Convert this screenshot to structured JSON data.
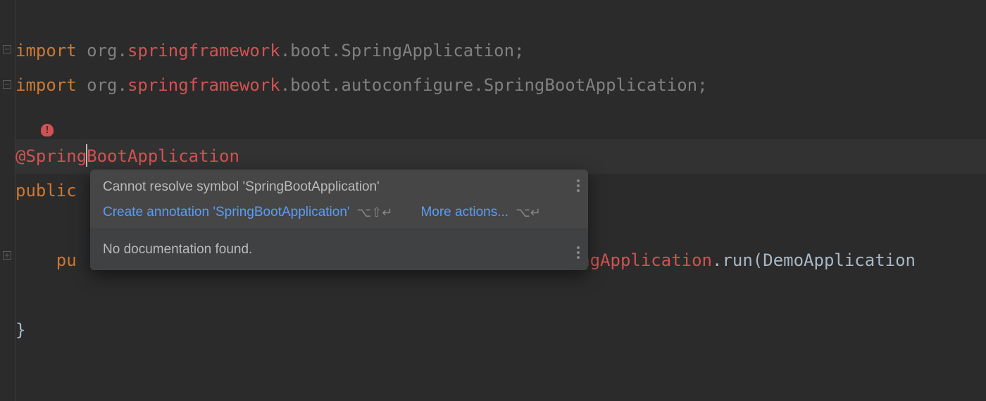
{
  "code": {
    "line1": {
      "import": "import ",
      "pkg1": "org.",
      "error": "springframework",
      "pkg2": ".boot.SpringApplication;"
    },
    "line2": {
      "import": "import ",
      "pkg1": "org.",
      "error": "springframework",
      "pkg2": ".boot.autoconfigure.SpringBootApplication;"
    },
    "annotation": {
      "at": "@",
      "part1": "Spring",
      "part2": "BootApplication"
    },
    "classDecl": {
      "public": "public"
    },
    "methodLine": {
      "indent": "    ",
      "pub": "pu",
      "rest_err": "ingApplication",
      "rest_norm": ".run(DemoApplication"
    },
    "closeBrace": "}"
  },
  "popup": {
    "title": "Cannot resolve symbol 'SpringBootApplication'",
    "action1": "Create annotation 'SpringBootApplication'",
    "shortcut1": "⌥⇧↵",
    "action2": "More actions...",
    "shortcut2": "⌥↵",
    "doc": "No documentation found."
  }
}
